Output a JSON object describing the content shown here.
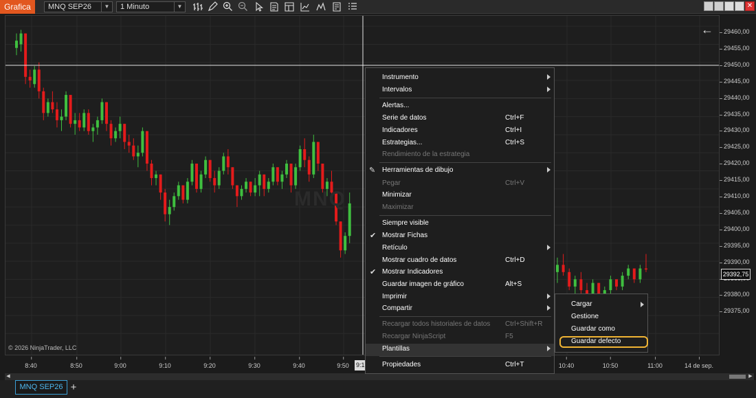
{
  "toolbar": {
    "title": "Grafica",
    "instrument": "MNQ SEP26",
    "interval": "1 Minuto",
    "icons": [
      "bar-style-icon",
      "draw-pencil-icon",
      "zoom-in-icon",
      "zoom-out-icon",
      "pointer-icon",
      "properties-icon",
      "data-box-icon",
      "strategy-icon",
      "templates-icon",
      "list-icon"
    ]
  },
  "chart": {
    "watermark": "MNQ",
    "copyright": "© 2026 NinjaTrader, LLC",
    "back_icon": "←",
    "y_ticks": [
      "29460,00",
      "29455,00",
      "29450,00",
      "29445,00",
      "29440,00",
      "29435,00",
      "29430,00",
      "29425,00",
      "29420,00",
      "29415,00",
      "29410,00",
      "29405,00",
      "29400,00",
      "29395,00",
      "29390,00",
      "29385,00",
      "29380,00",
      "29375,00"
    ],
    "x_ticks": [
      "8:40",
      "8:50",
      "9:00",
      "9:10",
      "9:20",
      "9:30",
      "9:40",
      "9:50",
      "10:40",
      "10:50",
      "11:00",
      "14 de sep."
    ],
    "crosshair_x_label": "9:1",
    "last_price": "29392,75",
    "colors": {
      "up": "#3fbf3f",
      "down": "#e31b1b",
      "crosshair": "#e6e6e6"
    }
  },
  "menu": {
    "items": [
      {
        "label": "Instrumento",
        "shortcut": "",
        "submenu": true,
        "disabled": false
      },
      {
        "label": "Intervalos",
        "shortcut": "",
        "submenu": true,
        "disabled": false
      },
      {
        "label": "Alertas...",
        "shortcut": "",
        "submenu": false,
        "disabled": false
      },
      {
        "label": "Serie de datos",
        "shortcut": "Ctrl+F",
        "submenu": false,
        "disabled": false
      },
      {
        "label": "Indicadores",
        "shortcut": "Ctrl+I",
        "submenu": false,
        "disabled": false
      },
      {
        "label": "Estrategias...",
        "shortcut": "Ctrl+S",
        "submenu": false,
        "disabled": false
      },
      {
        "label": "Rendimiento de la estrategia",
        "shortcut": "",
        "submenu": false,
        "disabled": true
      },
      {
        "label": "Herramientas de dibujo",
        "shortcut": "",
        "submenu": true,
        "disabled": false
      },
      {
        "label": "Pegar",
        "shortcut": "Ctrl+V",
        "submenu": false,
        "disabled": true
      },
      {
        "label": "Minimizar",
        "shortcut": "",
        "submenu": false,
        "disabled": false
      },
      {
        "label": "Maximizar",
        "shortcut": "",
        "submenu": false,
        "disabled": true
      },
      {
        "label": "Siempre visible",
        "shortcut": "",
        "submenu": false,
        "disabled": false
      },
      {
        "label": "Mostrar Fichas",
        "shortcut": "",
        "submenu": false,
        "disabled": false,
        "checked": true
      },
      {
        "label": "Retículo",
        "shortcut": "",
        "submenu": true,
        "disabled": false
      },
      {
        "label": "Mostrar cuadro de datos",
        "shortcut": "Ctrl+D",
        "submenu": false,
        "disabled": false
      },
      {
        "label": "Mostrar Indicadores",
        "shortcut": "",
        "submenu": false,
        "disabled": false,
        "checked": true
      },
      {
        "label": "Guardar imagen de gráfico",
        "shortcut": "Alt+S",
        "submenu": false,
        "disabled": false
      },
      {
        "label": "Imprimir",
        "shortcut": "",
        "submenu": true,
        "disabled": false
      },
      {
        "label": "Compartir",
        "shortcut": "",
        "submenu": true,
        "disabled": false
      },
      {
        "label": "Recargar todos historiales de datos",
        "shortcut": "Ctrl+Shift+R",
        "submenu": false,
        "disabled": true
      },
      {
        "label": "Recargar NinjaScript",
        "shortcut": "F5",
        "submenu": false,
        "disabled": true
      },
      {
        "label": "Plantillas",
        "shortcut": "",
        "submenu": true,
        "disabled": false,
        "highlighted": true
      },
      {
        "label": "Propiedades",
        "shortcut": "Ctrl+T",
        "submenu": false,
        "disabled": false
      }
    ]
  },
  "submenu": {
    "items": [
      {
        "label": "Cargar",
        "submenu": true
      },
      {
        "label": "Gestione",
        "submenu": false
      },
      {
        "label": "Guardar como",
        "submenu": false
      },
      {
        "label": "Guardar defecto",
        "submenu": false,
        "highlighted": true
      }
    ]
  },
  "tabs": {
    "active": "MNQ SEP26",
    "add": "+"
  }
}
